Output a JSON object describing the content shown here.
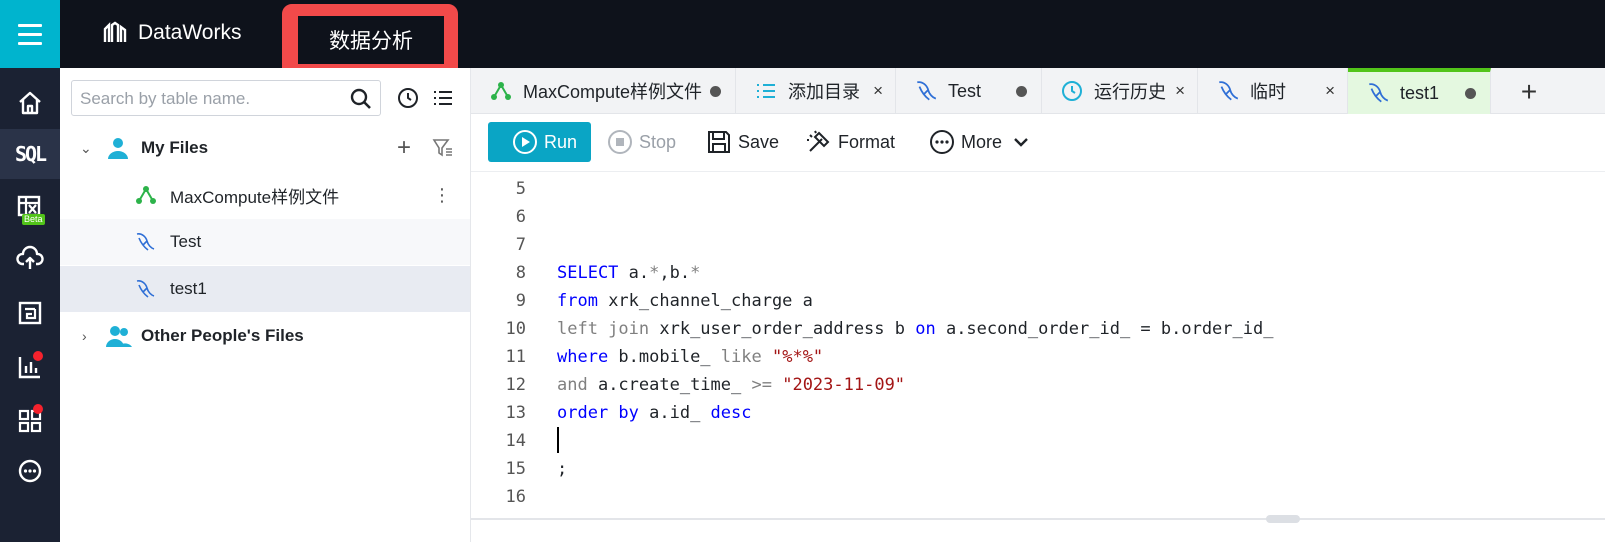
{
  "header": {
    "brand": "DataWorks",
    "active_module": "数据分析"
  },
  "rail": {
    "items": [
      {
        "icon": "home-icon"
      },
      {
        "icon": "sql-icon",
        "text": "SQL"
      },
      {
        "icon": "spreadsheet-icon",
        "badge": "Beta"
      },
      {
        "icon": "cloud-upload-icon"
      },
      {
        "icon": "report-icon"
      },
      {
        "icon": "chart-icon",
        "notification": true
      },
      {
        "icon": "apps-icon",
        "notification": true
      },
      {
        "icon": "more-icon"
      }
    ]
  },
  "sidebar": {
    "search_placeholder": "Search by table name.",
    "tree": {
      "my_files_label": "My Files",
      "files": [
        {
          "name": "MaxCompute样例文件",
          "icon": "workflow-icon"
        },
        {
          "name": "Test",
          "icon": "sql-file-icon"
        },
        {
          "name": "test1",
          "icon": "sql-file-icon"
        }
      ],
      "other_files_label": "Other People's Files"
    }
  },
  "tabs": [
    {
      "label": "MaxCompute样例文件",
      "icon": "workflow-icon",
      "status": "unsaved"
    },
    {
      "label": "添加目录",
      "icon": "list-icon",
      "status": "close"
    },
    {
      "label": "Test",
      "icon": "sql-file-icon",
      "status": "unsaved"
    },
    {
      "label": "运行历史",
      "icon": "clock-icon",
      "status": "close"
    },
    {
      "label": "临时",
      "icon": "sql-file-icon",
      "status": "close"
    },
    {
      "label": "test1",
      "icon": "sql-file-icon",
      "status": "unsaved",
      "active": true
    }
  ],
  "toolbar": {
    "run": "Run",
    "stop": "Stop",
    "save": "Save",
    "format": "Format",
    "more": "More"
  },
  "editor": {
    "line_numbers": [
      "5",
      "6",
      "7",
      "8",
      "9",
      "10",
      "11",
      "12",
      "13",
      "14",
      "15",
      "16"
    ],
    "tokens": {
      "l8": [
        "SELECT",
        " a.",
        "*",
        ",b.",
        "*"
      ],
      "l9": [
        "from",
        " xrk_channel_charge a"
      ],
      "l10": [
        "left join",
        " xrk_user_order_address b ",
        "on",
        " a.second_order_id_ = b.order_id_"
      ],
      "l11": [
        "where",
        " b.mobile_ ",
        "like",
        " ",
        "\"%*%\""
      ],
      "l12": [
        "and",
        " a.create_time_ ",
        ">=",
        " ",
        "\"2023-11-09\""
      ],
      "l13": [
        "order by",
        " a.id_ ",
        "desc"
      ],
      "l15": [
        ";"
      ]
    }
  },
  "colors": {
    "accent": "#0aa5c5",
    "keyword": "#0000ff",
    "string": "#a31515",
    "highlight": "#f24a4a",
    "active_tab": "#52c41a"
  }
}
